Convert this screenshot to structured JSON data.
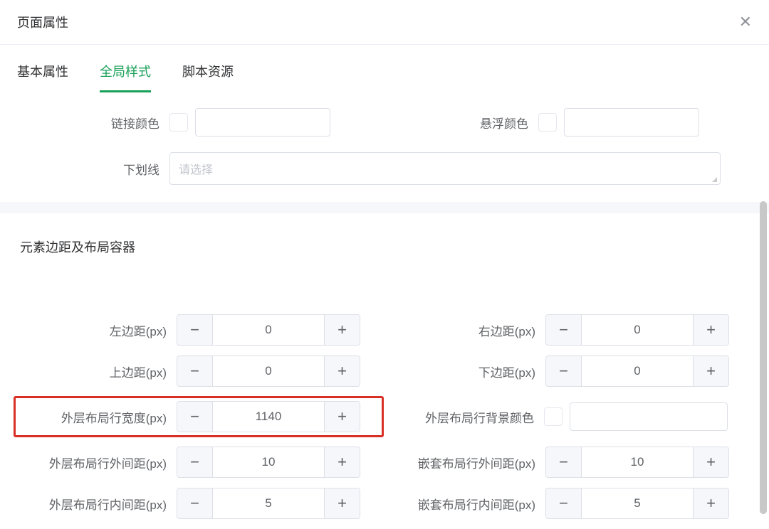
{
  "dialog": {
    "title": "页面属性"
  },
  "tabs": {
    "basic": "基本属性",
    "global": "全局样式",
    "script": "脚本资源"
  },
  "link": {
    "link_color_label": "链接颜色",
    "hover_color_label": "悬浮颜色",
    "underline_label": "下划线",
    "underline_placeholder": "请选择"
  },
  "section": {
    "title": "元素边距及布局容器"
  },
  "fields": {
    "left_margin": {
      "label": "左边距(px)",
      "value": "0"
    },
    "right_margin": {
      "label": "右边距(px)",
      "value": "0"
    },
    "top_margin": {
      "label": "上边距(px)",
      "value": "0"
    },
    "bottom_margin": {
      "label": "下边距(px)",
      "value": "0"
    },
    "outer_width": {
      "label": "外层布局行宽度(px)",
      "value": "1140"
    },
    "outer_bg": {
      "label": "外层布局行背景颜色"
    },
    "outer_outer": {
      "label": "外层布局行外间距(px)",
      "value": "10"
    },
    "nested_outer": {
      "label": "嵌套布局行外间距(px)",
      "value": "10"
    },
    "outer_inner": {
      "label": "外层布局行内间距(px)",
      "value": "5"
    },
    "nested_inner": {
      "label": "嵌套布局行内间距(px)",
      "value": "5"
    }
  },
  "glyph": {
    "minus": "−",
    "plus": "+"
  }
}
